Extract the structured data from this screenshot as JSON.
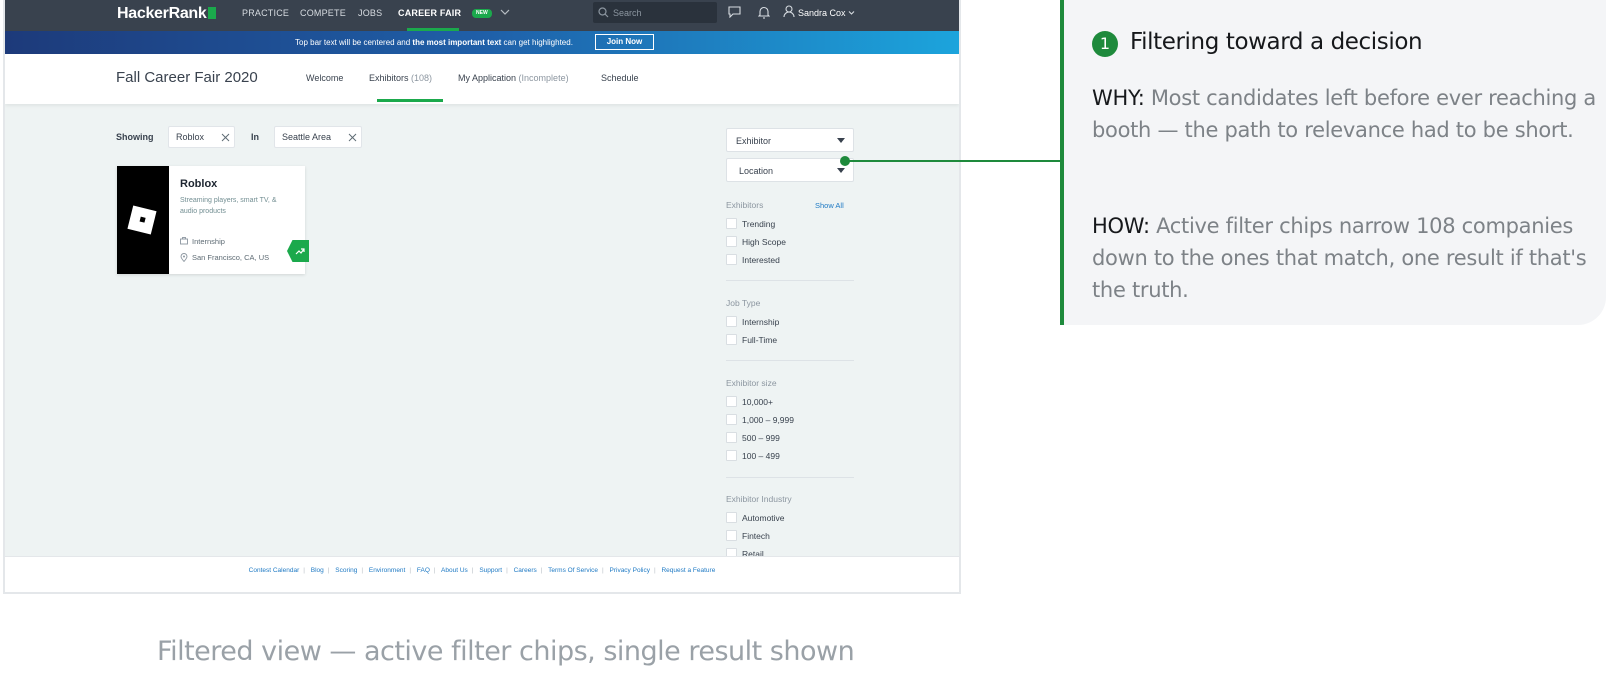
{
  "nav": {
    "logo": "HackerRank",
    "practice": "PRACTICE",
    "compete": "COMPETE",
    "jobs": "JOBS",
    "career_fair": "CAREER FAIR",
    "new_badge": "NEW",
    "search_placeholder": "Search",
    "user_name": "Sandra Cox"
  },
  "promo": {
    "text_before": "Top bar text will be centered and ",
    "text_bold": "the most important text",
    "text_after": " can get highlighted.",
    "button": "Join Now"
  },
  "header": {
    "title": "Fall Career Fair 2020",
    "tabs": [
      {
        "label": "Welcome",
        "extra": ""
      },
      {
        "label": "Exhibitors",
        "extra": "(108)"
      },
      {
        "label": "My Application",
        "extra": "(Incomplete)"
      },
      {
        "label": "Schedule",
        "extra": ""
      }
    ],
    "active_tab": "Exhibitors"
  },
  "filters_bar": {
    "showing_label": "Showing",
    "chip_company": "Roblox",
    "in_label": "In",
    "chip_location": "Seattle Area"
  },
  "result_card": {
    "name": "Roblox",
    "description": "Streaming players, smart TV, & audio products",
    "job_type": "Internship",
    "location": "San Francisco, CA, US"
  },
  "sidebar": {
    "dropdown_exhibitor": "Exhibitor",
    "dropdown_location": "Location",
    "exhibitors_title": "Exhibitors",
    "show_all": "Show All",
    "exhibitors": [
      "Trending",
      "High Scope",
      "Interested"
    ],
    "job_type_title": "Job Type",
    "job_types": [
      "Internship",
      "Full-Time"
    ],
    "size_title": "Exhibitor size",
    "sizes": [
      "10,000+",
      "1,000 – 9,999",
      "500 – 999",
      "100 – 499"
    ],
    "industry_title": "Exhibitor Industry",
    "industries": [
      "Automotive",
      "Fintech",
      "Retail"
    ]
  },
  "footer": {
    "links": [
      "Contest Calendar",
      "Blog",
      "Scoring",
      "Environment",
      "FAQ",
      "About Us",
      "Support",
      "Careers",
      "Terms Of Service",
      "Privacy Policy",
      "Request a Feature"
    ]
  },
  "annotation": {
    "number": "1",
    "title": "Filtering toward a decision",
    "why_label": "WHY:",
    "why_text": " Most candidates left before ever reaching a booth — the path to relevance had to be short.",
    "how_label": "HOW:",
    "how_text": " Active filter chips narrow 108 companies down to the ones that match, one result if that's the truth."
  },
  "caption": "Filtered view — active filter chips, single result shown",
  "colors": {
    "brand_green": "#1ba94c",
    "nav_dark": "#39424e",
    "annotation_accent": "#1e8a3c",
    "link_blue": "#1f7ac4"
  }
}
